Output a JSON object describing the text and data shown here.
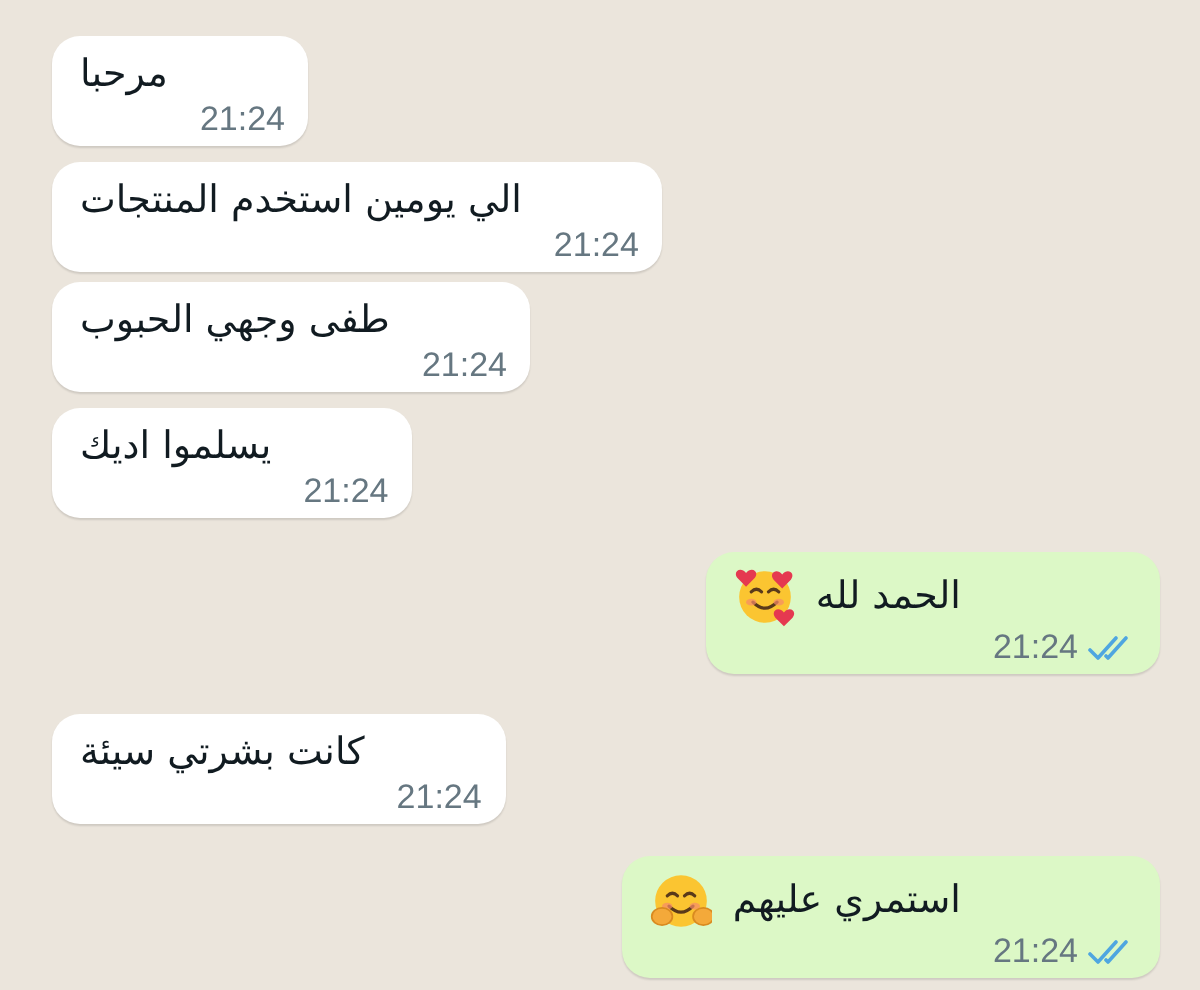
{
  "messages": [
    {
      "kind": "incoming",
      "text": "مرحبا",
      "time": "21:24"
    },
    {
      "kind": "incoming",
      "text": "الي يومين استخدم المنتجات",
      "time": "21:24"
    },
    {
      "kind": "incoming",
      "text": "طفى وجهي الحبوب",
      "time": "21:24"
    },
    {
      "kind": "incoming",
      "text": "يسلموا اديك",
      "time": "21:24"
    },
    {
      "kind": "outgoing",
      "text": "الحمد لله",
      "time": "21:24",
      "read": true,
      "emoji": {
        "kind": "hearts"
      }
    },
    {
      "kind": "incoming",
      "text": "كانت بشرتي سيئة",
      "time": "21:24"
    },
    {
      "kind": "outgoing",
      "text": "استمري عليهم",
      "time": "21:24",
      "read": true,
      "emoji": {
        "kind": "hug"
      }
    }
  ]
}
